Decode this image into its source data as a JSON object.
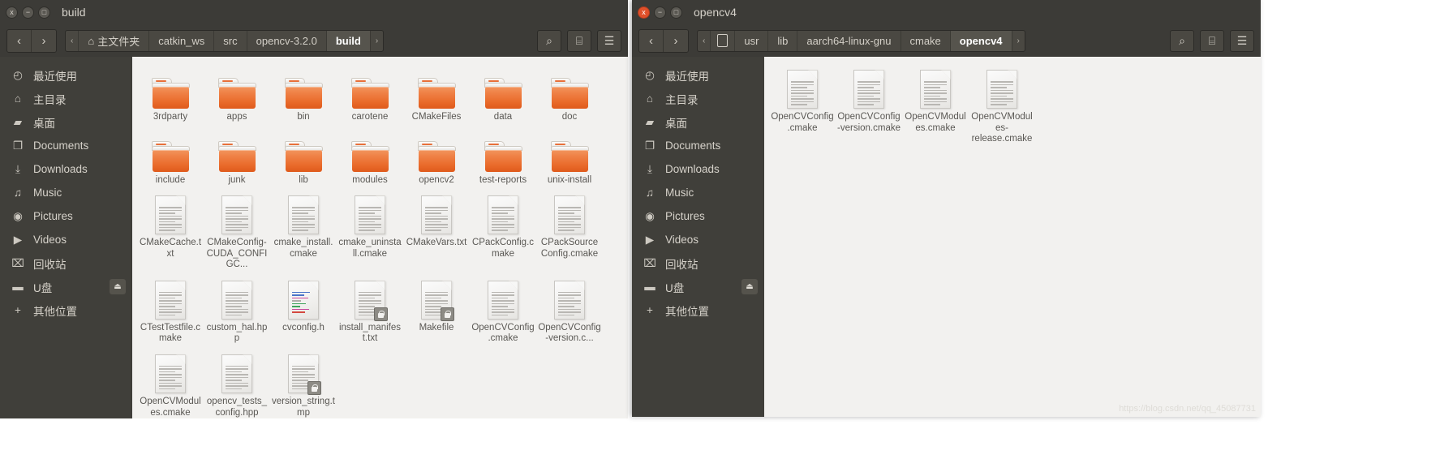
{
  "windows": [
    {
      "id": "build",
      "title": "build",
      "controls": {
        "close": "x",
        "minimize": "−",
        "maximize": "□",
        "close_active": false
      },
      "nav": {
        "back": "‹",
        "forward": "›"
      },
      "pathbar": {
        "overflow_left": "‹",
        "overflow_right": "›",
        "segments": [
          {
            "label": "主文件夹",
            "icon": "home-icon",
            "current": false
          },
          {
            "label": "catkin_ws",
            "icon": "",
            "current": false
          },
          {
            "label": "src",
            "icon": "",
            "current": false
          },
          {
            "label": "opencv-3.2.0",
            "icon": "",
            "current": false
          },
          {
            "label": "build",
            "icon": "",
            "current": true
          }
        ]
      },
      "toolbar_buttons": [
        {
          "name": "search-icon",
          "glyph": "⌕"
        },
        {
          "name": "view-options-icon",
          "glyph": "⌸"
        },
        {
          "name": "menu-icon",
          "glyph": "☰"
        }
      ],
      "sidebar": [
        {
          "label": "最近使用",
          "icon": "clock-icon",
          "glyph": "◴",
          "eject": false
        },
        {
          "label": "主目录",
          "icon": "home-icon",
          "glyph": "⌂",
          "eject": false
        },
        {
          "label": "桌面",
          "icon": "folder-icon",
          "glyph": "▰",
          "eject": false
        },
        {
          "label": "Documents",
          "icon": "document-icon",
          "glyph": "❐",
          "eject": false
        },
        {
          "label": "Downloads",
          "icon": "download-icon",
          "glyph": "⤓",
          "eject": false
        },
        {
          "label": "Music",
          "icon": "music-icon",
          "glyph": "♫",
          "eject": false
        },
        {
          "label": "Pictures",
          "icon": "camera-icon",
          "glyph": "◉",
          "eject": false
        },
        {
          "label": "Videos",
          "icon": "video-icon",
          "glyph": "▶",
          "eject": false
        },
        {
          "label": "回收站",
          "icon": "trash-icon",
          "glyph": "⌧",
          "eject": false
        },
        {
          "label": "U盘",
          "icon": "drive-icon",
          "glyph": "▬",
          "eject": true,
          "eject_glyph": "⏏"
        },
        {
          "label": "其他位置",
          "icon": "plus-icon",
          "glyph": "+",
          "eject": false
        }
      ],
      "files": [
        {
          "name": "3rdparty",
          "type": "folder"
        },
        {
          "name": "apps",
          "type": "folder"
        },
        {
          "name": "bin",
          "type": "folder"
        },
        {
          "name": "carotene",
          "type": "folder"
        },
        {
          "name": "CMakeFiles",
          "type": "folder"
        },
        {
          "name": "data",
          "type": "folder"
        },
        {
          "name": "doc",
          "type": "folder"
        },
        {
          "name": "include",
          "type": "folder"
        },
        {
          "name": "junk",
          "type": "folder"
        },
        {
          "name": "lib",
          "type": "folder"
        },
        {
          "name": "modules",
          "type": "folder"
        },
        {
          "name": "opencv2",
          "type": "folder"
        },
        {
          "name": "test-reports",
          "type": "folder"
        },
        {
          "name": "unix-install",
          "type": "folder"
        },
        {
          "name": "CMakeCache.txt",
          "type": "document"
        },
        {
          "name": "CMakeConfig-CUDA_CONFIGC...",
          "type": "document"
        },
        {
          "name": "cmake_install.cmake",
          "type": "document"
        },
        {
          "name": "cmake_uninstall.cmake",
          "type": "document"
        },
        {
          "name": "CMakeVars.txt",
          "type": "document"
        },
        {
          "name": "CPackConfig.cmake",
          "type": "document"
        },
        {
          "name": "CPackSourceConfig.cmake",
          "type": "document"
        },
        {
          "name": "CTestTestfile.cmake",
          "type": "document"
        },
        {
          "name": "custom_hal.hpp",
          "type": "document"
        },
        {
          "name": "cvconfig.h",
          "type": "code"
        },
        {
          "name": "install_manifest.txt",
          "type": "document-locked"
        },
        {
          "name": "Makefile",
          "type": "document-locked"
        },
        {
          "name": "OpenCVConfig.cmake",
          "type": "document"
        },
        {
          "name": "OpenCVConfig-version.c...",
          "type": "document"
        },
        {
          "name": "OpenCVModules.cmake",
          "type": "document"
        },
        {
          "name": "opencv_tests_config.hpp",
          "type": "document"
        },
        {
          "name": "version_string.tmp",
          "type": "document-locked"
        }
      ]
    },
    {
      "id": "opencv4",
      "title": "opencv4",
      "controls": {
        "close": "x",
        "minimize": "−",
        "maximize": "□",
        "close_active": true
      },
      "nav": {
        "back": "‹",
        "forward": "›"
      },
      "pathbar": {
        "overflow_left": "‹",
        "overflow_right": "›",
        "segments": [
          {
            "label": "",
            "icon": "filesystem-icon",
            "current": false
          },
          {
            "label": "usr",
            "icon": "",
            "current": false
          },
          {
            "label": "lib",
            "icon": "",
            "current": false
          },
          {
            "label": "aarch64-linux-gnu",
            "icon": "",
            "current": false
          },
          {
            "label": "cmake",
            "icon": "",
            "current": false
          },
          {
            "label": "opencv4",
            "icon": "",
            "current": true
          }
        ]
      },
      "toolbar_buttons": [
        {
          "name": "search-icon",
          "glyph": "⌕"
        },
        {
          "name": "view-options-icon",
          "glyph": "⌸"
        },
        {
          "name": "menu-icon",
          "glyph": "☰"
        }
      ],
      "sidebar": [
        {
          "label": "最近使用",
          "icon": "clock-icon",
          "glyph": "◴",
          "eject": false
        },
        {
          "label": "主目录",
          "icon": "home-icon",
          "glyph": "⌂",
          "eject": false
        },
        {
          "label": "桌面",
          "icon": "folder-icon",
          "glyph": "▰",
          "eject": false
        },
        {
          "label": "Documents",
          "icon": "document-icon",
          "glyph": "❐",
          "eject": false
        },
        {
          "label": "Downloads",
          "icon": "download-icon",
          "glyph": "⤓",
          "eject": false
        },
        {
          "label": "Music",
          "icon": "music-icon",
          "glyph": "♫",
          "eject": false
        },
        {
          "label": "Pictures",
          "icon": "camera-icon",
          "glyph": "◉",
          "eject": false
        },
        {
          "label": "Videos",
          "icon": "video-icon",
          "glyph": "▶",
          "eject": false
        },
        {
          "label": "回收站",
          "icon": "trash-icon",
          "glyph": "⌧",
          "eject": false
        },
        {
          "label": "U盘",
          "icon": "drive-icon",
          "glyph": "▬",
          "eject": true,
          "eject_glyph": "⏏"
        },
        {
          "label": "其他位置",
          "icon": "plus-icon",
          "glyph": "+",
          "eject": false
        }
      ],
      "files": [
        {
          "name": "OpenCVConfig.cmake",
          "type": "document"
        },
        {
          "name": "OpenCVConfig-version.cmake",
          "type": "document"
        },
        {
          "name": "OpenCVModules.cmake",
          "type": "document"
        },
        {
          "name": "OpenCVModules-release.cmake",
          "type": "document"
        }
      ]
    }
  ],
  "watermark": "https://blog.csdn.net/qq_45087731",
  "colors": {
    "chrome": "#3c3b37",
    "sidebar": "#403f3a",
    "content": "#f2f1ef",
    "folder_orange": "#ef8146",
    "close_active": "#e0502a"
  }
}
